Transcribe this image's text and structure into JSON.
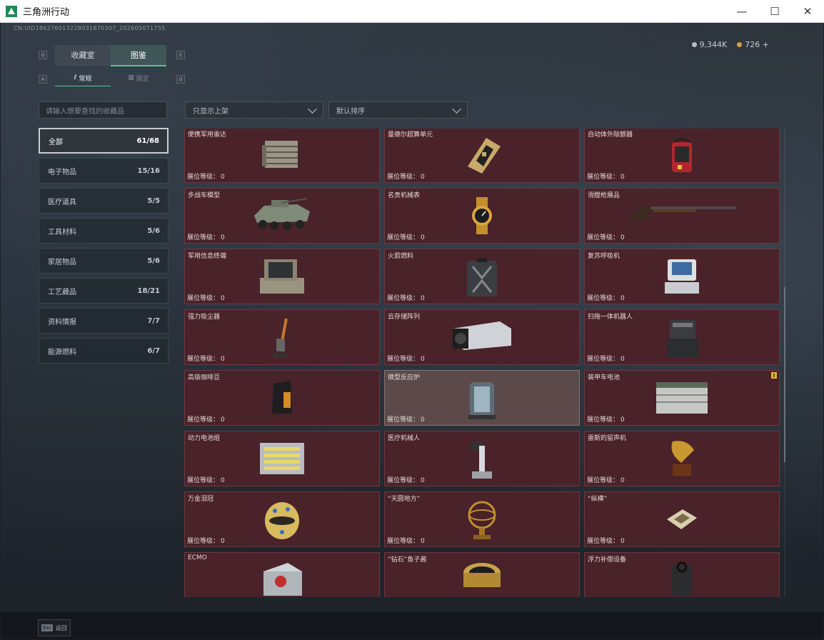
{
  "window": {
    "title": "三角洲行动"
  },
  "uid": "CN:UID18627601322803187030​7_202605071755",
  "currency": [
    {
      "icon": "silver-coin-icon",
      "value": "9,344K"
    },
    {
      "icon": "gold-coin-icon",
      "value": "726 +"
    }
  ],
  "main_tabs": [
    {
      "label": "收藏室",
      "active": false
    },
    {
      "label": "图鉴",
      "active": true
    }
  ],
  "sub_tabs": [
    {
      "label": "常规",
      "active": true
    },
    {
      "label": "限定",
      "active": false
    }
  ],
  "key_hints": {
    "q": "Q",
    "e": "E",
    "a": "A",
    "d": "D"
  },
  "search": {
    "placeholder": "请输入想要查找的收藏品"
  },
  "filters": {
    "display": "只显示上架",
    "sort": "默认排序"
  },
  "categories": [
    {
      "label": "全部",
      "count": "61/68",
      "active": true
    },
    {
      "label": "电子物品",
      "count": "15/16"
    },
    {
      "label": "医疗道具",
      "count": "5/5"
    },
    {
      "label": "工具材料",
      "count": "5/6"
    },
    {
      "label": "家居物品",
      "count": "5/6"
    },
    {
      "label": "工艺藏品",
      "count": "18/21"
    },
    {
      "label": "资料情报",
      "count": "7/7"
    },
    {
      "label": "能源燃料",
      "count": "6/7"
    }
  ],
  "level_label": "展位等级：",
  "items": [
    {
      "name": "便携军用雷达",
      "level": "0",
      "icon": "radar-icon"
    },
    {
      "name": "曼德尔超算单元",
      "level": "0",
      "icon": "circuit-board-icon"
    },
    {
      "name": "自动体外除颤器",
      "level": "0",
      "icon": "defibrillator-icon"
    },
    {
      "name": "步战车模型",
      "level": "0",
      "icon": "armored-vehicle-icon"
    },
    {
      "name": "名贵机械表",
      "level": "0",
      "icon": "watch-icon"
    },
    {
      "name": "滑膛枪展品",
      "level": "0",
      "icon": "musket-icon"
    },
    {
      "name": "军用信息终端",
      "level": "0",
      "icon": "terminal-case-icon"
    },
    {
      "name": "火箭燃料",
      "level": "0",
      "icon": "fuel-canister-icon"
    },
    {
      "name": "复苏呼吸机",
      "level": "0",
      "icon": "ventilator-icon"
    },
    {
      "name": "强力吸尘器",
      "level": "0",
      "icon": "vacuum-icon"
    },
    {
      "name": "云存储阵列",
      "level": "0",
      "icon": "storage-array-icon"
    },
    {
      "name": "扫拖一体机器人",
      "level": "0",
      "icon": "robot-mop-icon"
    },
    {
      "name": "高级咖啡豆",
      "level": "0",
      "icon": "coffee-bag-icon"
    },
    {
      "name": "微型反应炉",
      "level": "0",
      "icon": "reactor-icon",
      "highlight": true
    },
    {
      "name": "装甲车电池",
      "level": "0",
      "icon": "battery-icon",
      "warning": "!"
    },
    {
      "name": "动力电池组",
      "level": "0",
      "icon": "battery-pack-icon"
    },
    {
      "name": "医疗机械人",
      "level": "0",
      "icon": "medical-robot-icon"
    },
    {
      "name": "雷斯的留声机",
      "level": "0",
      "icon": "gramophone-icon"
    },
    {
      "name": "万金泪冠",
      "level": "0",
      "icon": "jeweled-egg-icon"
    },
    {
      "name": "“天圆地方”",
      "level": "0",
      "icon": "armillary-icon"
    },
    {
      "name": "“纵横”",
      "level": "0",
      "icon": "chessboard-icon"
    },
    {
      "name": "ECMO",
      "level": "",
      "icon": "ecmo-icon"
    },
    {
      "name": "“钻石”鱼子酱",
      "level": "",
      "icon": "caviar-tin-icon"
    },
    {
      "name": "浮力补偿设备",
      "level": "",
      "icon": "buoyancy-device-icon"
    }
  ],
  "bottom": {
    "esc_key": "Esc",
    "esc_label": "返回"
  }
}
